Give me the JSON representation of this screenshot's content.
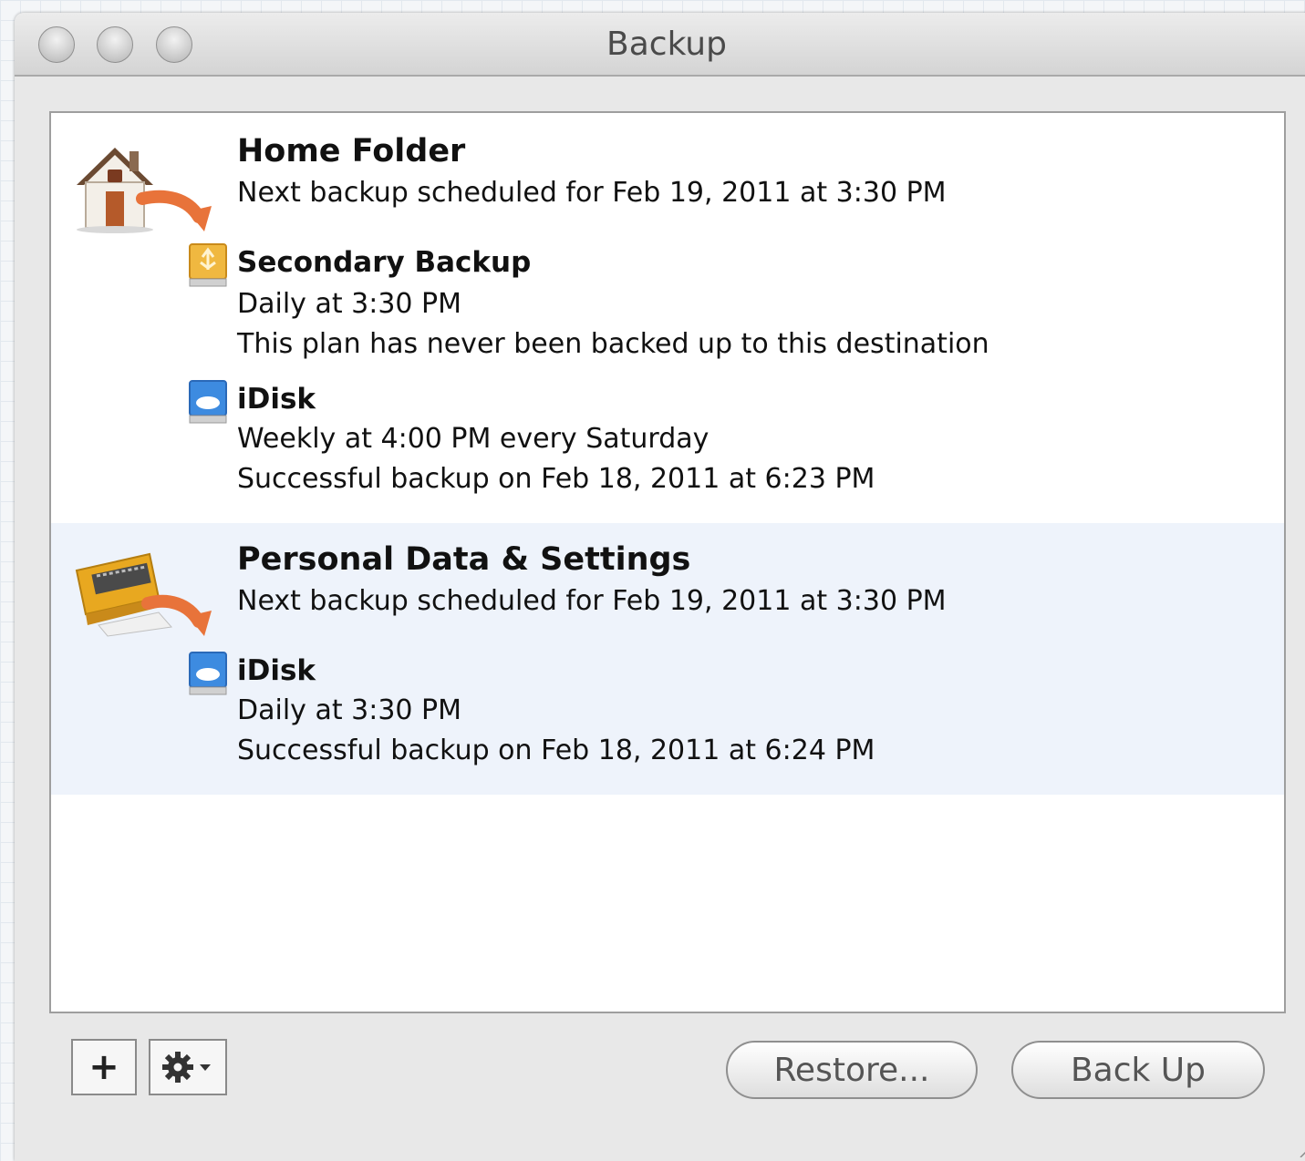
{
  "window": {
    "title": "Backup"
  },
  "plans": [
    {
      "title": "Home Folder",
      "subtitle": "Next backup scheduled for Feb 19, 2011 at 3:30 PM",
      "icon": "home-folder-icon",
      "destinations": [
        {
          "name": "Secondary Backup",
          "schedule": "Daily at 3:30 PM",
          "status": "This plan has never been backed up to this destination",
          "icon": "external-drive-icon"
        },
        {
          "name": "iDisk",
          "schedule": "Weekly at 4:00 PM every Saturday",
          "status": "Successful backup on Feb 18, 2011 at 6:23 PM",
          "icon": "idisk-icon"
        }
      ]
    },
    {
      "title": "Personal Data & Settings",
      "subtitle": "Next backup scheduled for Feb 19, 2011 at 3:30 PM",
      "icon": "personal-data-icon",
      "selected": true,
      "destinations": [
        {
          "name": "iDisk",
          "schedule": "Daily at 3:30 PM",
          "status": "Successful backup on Feb 18, 2011 at 6:24 PM",
          "icon": "idisk-icon"
        }
      ]
    }
  ],
  "toolbar": {
    "add_label": "+",
    "restore_label": "Restore...",
    "backup_label": "Back Up"
  },
  "colors": {
    "selection": "#eef3fb",
    "arrow": "#e8733a"
  }
}
